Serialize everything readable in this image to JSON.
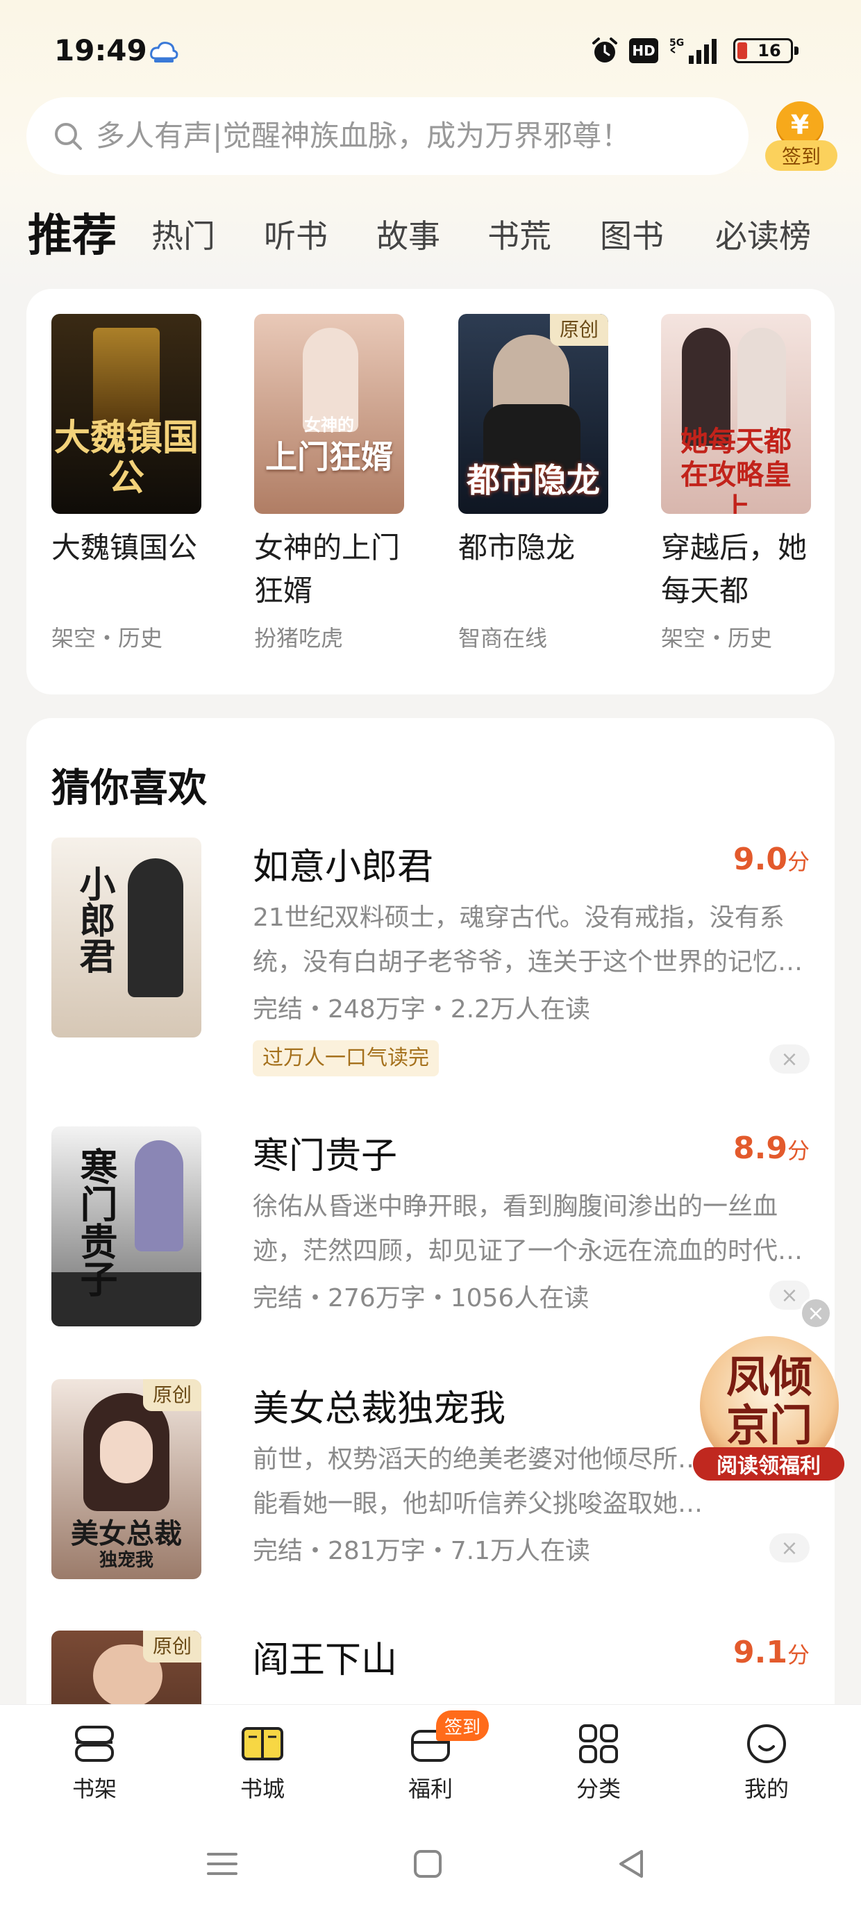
{
  "status_bar": {
    "time": "19:49",
    "hd_label": "HD",
    "network": "5G",
    "battery": "16",
    "cloud_icon": "cloud-icon"
  },
  "search": {
    "placeholder": "多人有声|觉醒神族血脉，成为万界邪尊！",
    "checkin_coin": "¥",
    "checkin_label": "签到"
  },
  "tabs": [
    {
      "label": "推荐",
      "active": true
    },
    {
      "label": "热门"
    },
    {
      "label": "听书"
    },
    {
      "label": "故事"
    },
    {
      "label": "书荒"
    },
    {
      "label": "图书"
    },
    {
      "label": "必读榜"
    }
  ],
  "featured": [
    {
      "cover_text": "大魏镇国公",
      "title": "大魏镇国公",
      "meta": "架空・历史",
      "badge": "",
      "cover_colors": [
        "#3a2a14",
        "#0f0c08"
      ]
    },
    {
      "cover_text": "上门狂婿",
      "cover_sub": "女神的",
      "title": "女神的上门狂婿",
      "meta": "扮猪吃虎",
      "badge": "",
      "cover_colors": [
        "#e9c9b8",
        "#b07d64"
      ]
    },
    {
      "cover_text": "都市隐龙",
      "title": "都市隐龙",
      "meta": "智商在线",
      "badge": "原创",
      "cover_colors": [
        "#2d3c52",
        "#0f1622"
      ]
    },
    {
      "cover_text": "她每天都在攻略皇上",
      "title": "穿越后，她每天都",
      "meta": "架空・历史",
      "badge": "",
      "cover_colors": [
        "#f4e4df",
        "#d8b6ad"
      ]
    }
  ],
  "list": {
    "header": "猜你喜欢",
    "items": [
      {
        "cover_text": "小郎君",
        "title": "如意小郎君",
        "score": "9.0",
        "score_unit": "分",
        "desc_line1": "21世纪双料硕士，魂穿古代。没有戒指，没有系",
        "desc_line2": "统，没有白胡子老爷爷，连关于这个世界的记忆都…",
        "meta": "完结・248万字・2.2万人在读",
        "tag": "过万人一口气读完",
        "badge": "",
        "cover_colors": [
          "#f6f1ea",
          "#d6c7b5"
        ]
      },
      {
        "cover_text": "寒门贵子",
        "title": "寒门贵子",
        "score": "8.9",
        "score_unit": "分",
        "desc_line1": "徐佑从昏迷中睁开眼，看到胸腹间渗出的一丝血",
        "desc_line2": "迹，茫然四顾，却见证了一个永远在流血的时代！…",
        "meta": "完结・276万字・1056人在读",
        "tag": "",
        "badge": "",
        "cover_colors": [
          "#f3f3f3",
          "#6b6b6b"
        ]
      },
      {
        "cover_text": "美女总裁",
        "cover_sub": "独宠我",
        "title": "美女总裁独宠我",
        "score": "",
        "score_unit": "",
        "desc_line1": "前世，权势滔天的绝美老婆对他倾尽所有，",
        "desc_line2": "能看她一眼，他却听信养父挑唆盗取她公司机密，…",
        "meta": "完结・281万字・7.1万人在读",
        "tag": "",
        "badge": "原创",
        "cover_colors": [
          "#f1e6de",
          "#9b7b6a"
        ]
      },
      {
        "cover_text": "",
        "title": "阎王下山",
        "score": "9.1",
        "score_unit": "分",
        "desc_line1": "",
        "desc_line2": "",
        "meta": "",
        "tag": "",
        "badge": "原创",
        "cover_colors": [
          "#7a4a35",
          "#3a2218"
        ]
      }
    ]
  },
  "float_ad": {
    "text": "凤倾京门",
    "banner": "阅读领福利",
    "close": "×"
  },
  "dismiss_symbol": "×",
  "bottom_nav": [
    {
      "label": "书架",
      "icon": "bookshelf-icon"
    },
    {
      "label": "书城",
      "icon": "bookstore-icon",
      "active": true
    },
    {
      "label": "福利",
      "icon": "gift-icon",
      "badge": "签到"
    },
    {
      "label": "分类",
      "icon": "category-icon"
    },
    {
      "label": "我的",
      "icon": "profile-icon"
    }
  ],
  "colors": {
    "accent_yellow": "#f7d744",
    "score_red": "#e35a2c",
    "badge_orange": "#ff6b1a"
  }
}
